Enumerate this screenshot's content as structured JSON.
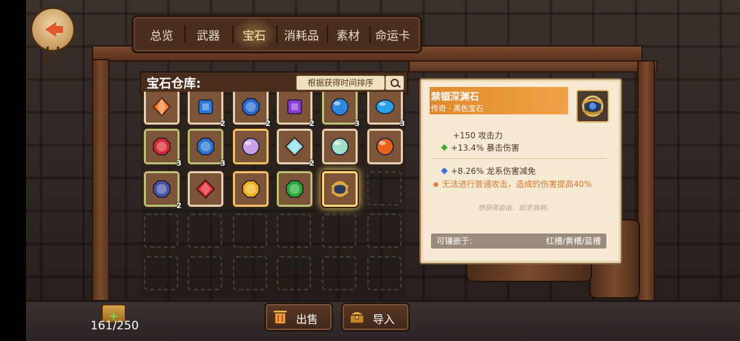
{
  "nav": {
    "back_icon": "back-arrow-icon"
  },
  "tabs": [
    {
      "label": "总览",
      "active": false
    },
    {
      "label": "武器",
      "active": false
    },
    {
      "label": "宝石",
      "active": true
    },
    {
      "label": "消耗品",
      "active": false
    },
    {
      "label": "素材",
      "active": false
    },
    {
      "label": "命运卡",
      "active": false
    }
  ],
  "warehouse": {
    "title": "宝石仓库:",
    "sort_label": "根据获得时间排序",
    "search_icon": "magnifier-icon",
    "items": [
      {
        "gem": "orange-crystal",
        "color": "#f07a24",
        "qty": ""
      },
      {
        "gem": "blue-square-gem",
        "color": "#2a78d8",
        "qty": "2"
      },
      {
        "gem": "blue-octagon-gem",
        "color": "#2a6bd0",
        "qty": "2"
      },
      {
        "gem": "purple-square-gem",
        "color": "#8a3ad8",
        "qty": "2"
      },
      {
        "gem": "blue-round-gem",
        "color": "#2a8ae0",
        "qty": "3"
      },
      {
        "gem": "blue-oval-gem",
        "color": "#2aa0e8",
        "qty": "3"
      },
      {
        "gem": "red-octagon-gem",
        "color": "#d82a36",
        "qty": "3"
      },
      {
        "gem": "blue-hexagon-gem",
        "color": "#2a74d4",
        "qty": "3"
      },
      {
        "gem": "rainbow-opal-gem",
        "color": "#c8a0e8",
        "qty": ""
      },
      {
        "gem": "prism-diamond-gem",
        "color": "#8ee0e8",
        "qty": "2"
      },
      {
        "gem": "iridescent-pearl-gem",
        "color": "#a0e0c8",
        "qty": ""
      },
      {
        "gem": "fire-orb-gem",
        "color": "#e8621a",
        "qty": ""
      },
      {
        "gem": "indigo-octagon-gem",
        "color": "#4a52a8",
        "qty": "2"
      },
      {
        "gem": "red-diamond-gem",
        "color": "#e0262e",
        "qty": ""
      },
      {
        "gem": "gold-octagon-gem",
        "color": "#f0b020",
        "qty": ""
      },
      {
        "gem": "green-octagon-gem",
        "color": "#2aa83a",
        "qty": ""
      },
      {
        "gem": "chained-abyss-stone",
        "color": "#e0a83a",
        "qty": "",
        "selected": true
      }
    ],
    "capacity": "161/250"
  },
  "detail": {
    "name": "禁锢深渊石",
    "type": "传奇 · 黑色宝石",
    "icon": "chained-abyss-stone-icon",
    "base_stats": [
      {
        "text": "+150 攻击力",
        "marker": ""
      },
      {
        "text": "+13.4% 暴击伤害",
        "marker": "green"
      }
    ],
    "bonus_stats": [
      {
        "text": "+8.26% 龙系伤害减免",
        "marker": "blue"
      }
    ],
    "special": "无法进行普通攻击，造成的伤害提高40%",
    "flavor": "想获得自由，就求我啊。",
    "socket_label": "可镶嵌于:",
    "socket_value": "红槽/黄槽/蓝槽"
  },
  "actions": {
    "sell_label": "出售",
    "import_label": "导入",
    "sell_icon": "trash-can-icon",
    "import_icon": "treasure-chest-icon"
  },
  "colors": {
    "accent": "#f1a246",
    "panel": "#4a2e1d",
    "card": "#f6ead4",
    "marker_green": "#4aa83a",
    "marker_blue": "#3a74d8"
  }
}
